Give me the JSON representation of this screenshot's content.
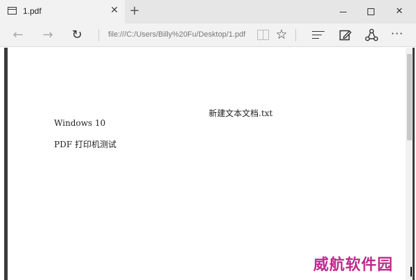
{
  "tab": {
    "title": "1.pdf",
    "close_glyph": "✕",
    "new_tab_glyph": "+"
  },
  "window_controls": {
    "close_glyph": "✕"
  },
  "navbar": {
    "back_glyph": "←",
    "forward_glyph": "→",
    "refresh_glyph": "↻",
    "address": "file:///C:/Users/Billy%20Fu/Desktop/1.pdf",
    "favorite_glyph": "☆",
    "more_glyph": "···"
  },
  "icons": {
    "tab": "tab-page-icon",
    "reading_view": "reading-view-icon",
    "favorite": "star-icon",
    "hub": "hub-icon",
    "web_note": "web-note-icon",
    "share": "share-icon",
    "more": "more-icon"
  },
  "document": {
    "header": "新建文本文档.txt",
    "lines": [
      "Windows 10",
      "PDF 打印机测试"
    ]
  },
  "watermark": "威航软件园",
  "colors": {
    "tab_bar": "#e6e6e6",
    "active_tab": "#f2f2f2",
    "watermark": "#c02a8c"
  }
}
